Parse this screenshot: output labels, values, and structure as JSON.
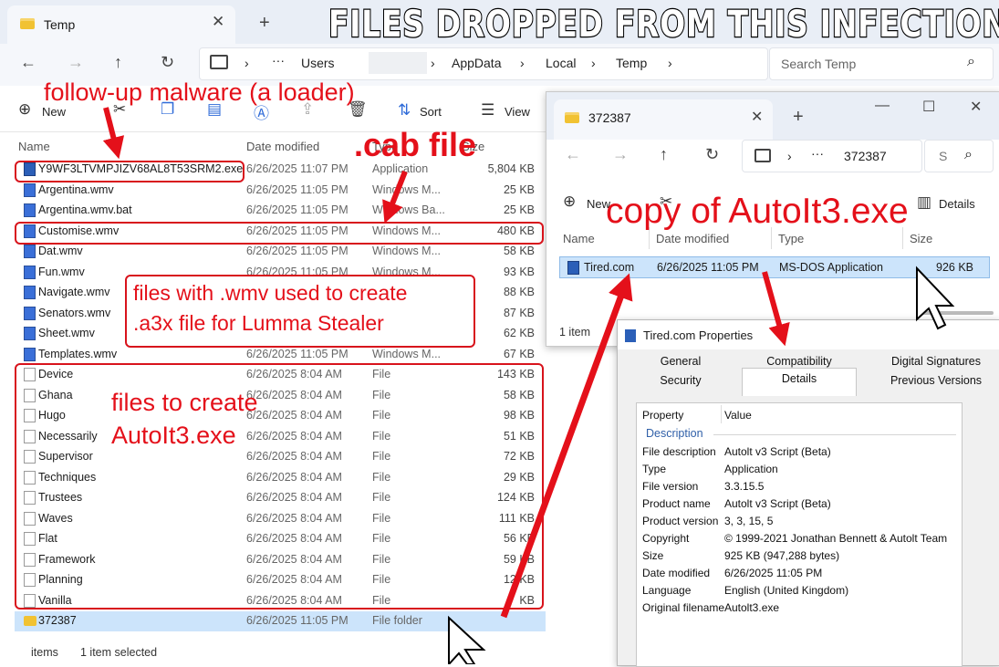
{
  "banner": "FILES DROPPED FROM THIS INFECTION",
  "main_window": {
    "tab_title": "Temp",
    "new_tab": "+",
    "breadcrumb": [
      "Users",
      "AppData",
      "Local",
      "Temp"
    ],
    "search_placeholder": "Search Temp",
    "toolbar": {
      "new": "New",
      "sort": "Sort",
      "view": "View"
    },
    "columns": {
      "name": "Name",
      "date": "Date modified",
      "type": "Type",
      "size": "Size"
    },
    "files": [
      {
        "name": "Y9WF3LTVMPJIZV68AL8T53SRM2.exe",
        "date": "6/26/2025 11:07 PM",
        "type": "Application",
        "size": "5,804 KB",
        "icon": "exe"
      },
      {
        "name": "Argentina.wmv",
        "date": "6/26/2025 11:05 PM",
        "type": "Windows M...",
        "size": "25 KB",
        "icon": "media"
      },
      {
        "name": "Argentina.wmv.bat",
        "date": "6/26/2025 11:05 PM",
        "type": "Windows Ba...",
        "size": "25 KB",
        "icon": "media"
      },
      {
        "name": "Customise.wmv",
        "date": "6/26/2025 11:05 PM",
        "type": "Windows M...",
        "size": "480 KB",
        "icon": "media"
      },
      {
        "name": "Dat.wmv",
        "date": "6/26/2025 11:05 PM",
        "type": "Windows M...",
        "size": "58 KB",
        "icon": "media"
      },
      {
        "name": "Fun.wmv",
        "date": "6/26/2025 11:05 PM",
        "type": "Windows M...",
        "size": "93 KB",
        "icon": "media"
      },
      {
        "name": "Navigate.wmv",
        "date": "",
        "type": "",
        "size": "88 KB",
        "icon": "media"
      },
      {
        "name": "Senators.wmv",
        "date": "",
        "type": "",
        "size": "87 KB",
        "icon": "media"
      },
      {
        "name": "Sheet.wmv",
        "date": "",
        "type": "",
        "size": "62 KB",
        "icon": "media"
      },
      {
        "name": "Templates.wmv",
        "date": "6/26/2025 11:05 PM",
        "type": "Windows M...",
        "size": "67 KB",
        "icon": "media"
      },
      {
        "name": "Device",
        "date": "6/26/2025 8:04 AM",
        "type": "File",
        "size": "143 KB",
        "icon": "file"
      },
      {
        "name": "Ghana",
        "date": "6/26/2025 8:04 AM",
        "type": "File",
        "size": "58 KB",
        "icon": "file"
      },
      {
        "name": "Hugo",
        "date": "6/26/2025 8:04 AM",
        "type": "File",
        "size": "98 KB",
        "icon": "file"
      },
      {
        "name": "Necessarily",
        "date": "6/26/2025 8:04 AM",
        "type": "File",
        "size": "51 KB",
        "icon": "file"
      },
      {
        "name": "Supervisor",
        "date": "6/26/2025 8:04 AM",
        "type": "File",
        "size": "72 KB",
        "icon": "file"
      },
      {
        "name": "Techniques",
        "date": "6/26/2025 8:04 AM",
        "type": "File",
        "size": "29 KB",
        "icon": "file"
      },
      {
        "name": "Trustees",
        "date": "6/26/2025 8:04 AM",
        "type": "File",
        "size": "124 KB",
        "icon": "file"
      },
      {
        "name": "Waves",
        "date": "6/26/2025 8:04 AM",
        "type": "File",
        "size": "111 KB",
        "icon": "file"
      },
      {
        "name": "Flat",
        "date": "6/26/2025 8:04 AM",
        "type": "File",
        "size": "56 KB",
        "icon": "file"
      },
      {
        "name": "Framework",
        "date": "6/26/2025 8:04 AM",
        "type": "File",
        "size": "59 KB",
        "icon": "file"
      },
      {
        "name": "Planning",
        "date": "6/26/2025 8:04 AM",
        "type": "File",
        "size": "12 KB",
        "icon": "file"
      },
      {
        "name": "Vanilla",
        "date": "6/26/2025 8:04 AM",
        "type": "File",
        "size": "KB",
        "icon": "file"
      },
      {
        "name": "372387",
        "date": "6/26/2025 11:05 PM",
        "type": "File folder",
        "size": "",
        "icon": "folder"
      }
    ],
    "status": {
      "items": "items",
      "selected": "1 item selected"
    }
  },
  "folder_window": {
    "tab_title": "372387",
    "new_tab": "+",
    "breadcrumb": "372387",
    "search_placeholder": "S",
    "toolbar": {
      "new": "New",
      "details": "Details"
    },
    "columns": {
      "name": "Name",
      "date": "Date modified",
      "type": "Type",
      "size": "Size"
    },
    "file": {
      "name": "Tired.com",
      "date": "6/26/2025 11:05 PM",
      "type": "MS-DOS Application",
      "size": "926 KB"
    },
    "status": "1 item"
  },
  "properties": {
    "title": "Tired.com Properties",
    "tabs_top": [
      "General",
      "Compatibility",
      "Digital Signatures"
    ],
    "tabs_bottom": [
      "Security",
      "Details",
      "Previous Versions"
    ],
    "active_tab": "Details",
    "header": {
      "property": "Property",
      "value": "Value"
    },
    "section": "Description",
    "rows": [
      {
        "k": "File description",
        "v": "Autolt v3 Script (Beta)"
      },
      {
        "k": "Type",
        "v": "Application"
      },
      {
        "k": "File version",
        "v": "3.3.15.5"
      },
      {
        "k": "Product name",
        "v": "Autolt v3 Script (Beta)"
      },
      {
        "k": "Product version",
        "v": "3, 3, 15, 5"
      },
      {
        "k": "Copyright",
        "v": "© 1999-2021 Jonathan Bennett & Autolt Team"
      },
      {
        "k": "Size",
        "v": "925 KB (947,288 bytes)"
      },
      {
        "k": "Date modified",
        "v": "6/26/2025 11:05 PM"
      },
      {
        "k": "Language",
        "v": "English (United Kingdom)"
      },
      {
        "k": "Original filename",
        "v": "Autolt3.exe"
      }
    ]
  },
  "annotations": {
    "loader": "follow-up malware (a loader)",
    "cab": ".cab file",
    "wmv_line1": "files with .wmv used to create",
    "wmv_line2": ".a3x file for Lumma Stealer",
    "autoit_line1": "files to create",
    "autoit_line2": "AutoIt3.exe",
    "copy": "copy of AutoIt3.exe"
  },
  "colors": {
    "annotation": "#e4101a",
    "selection": "#cce4fb",
    "titlebar": "#e9eef6",
    "folder": "#f1c232"
  }
}
